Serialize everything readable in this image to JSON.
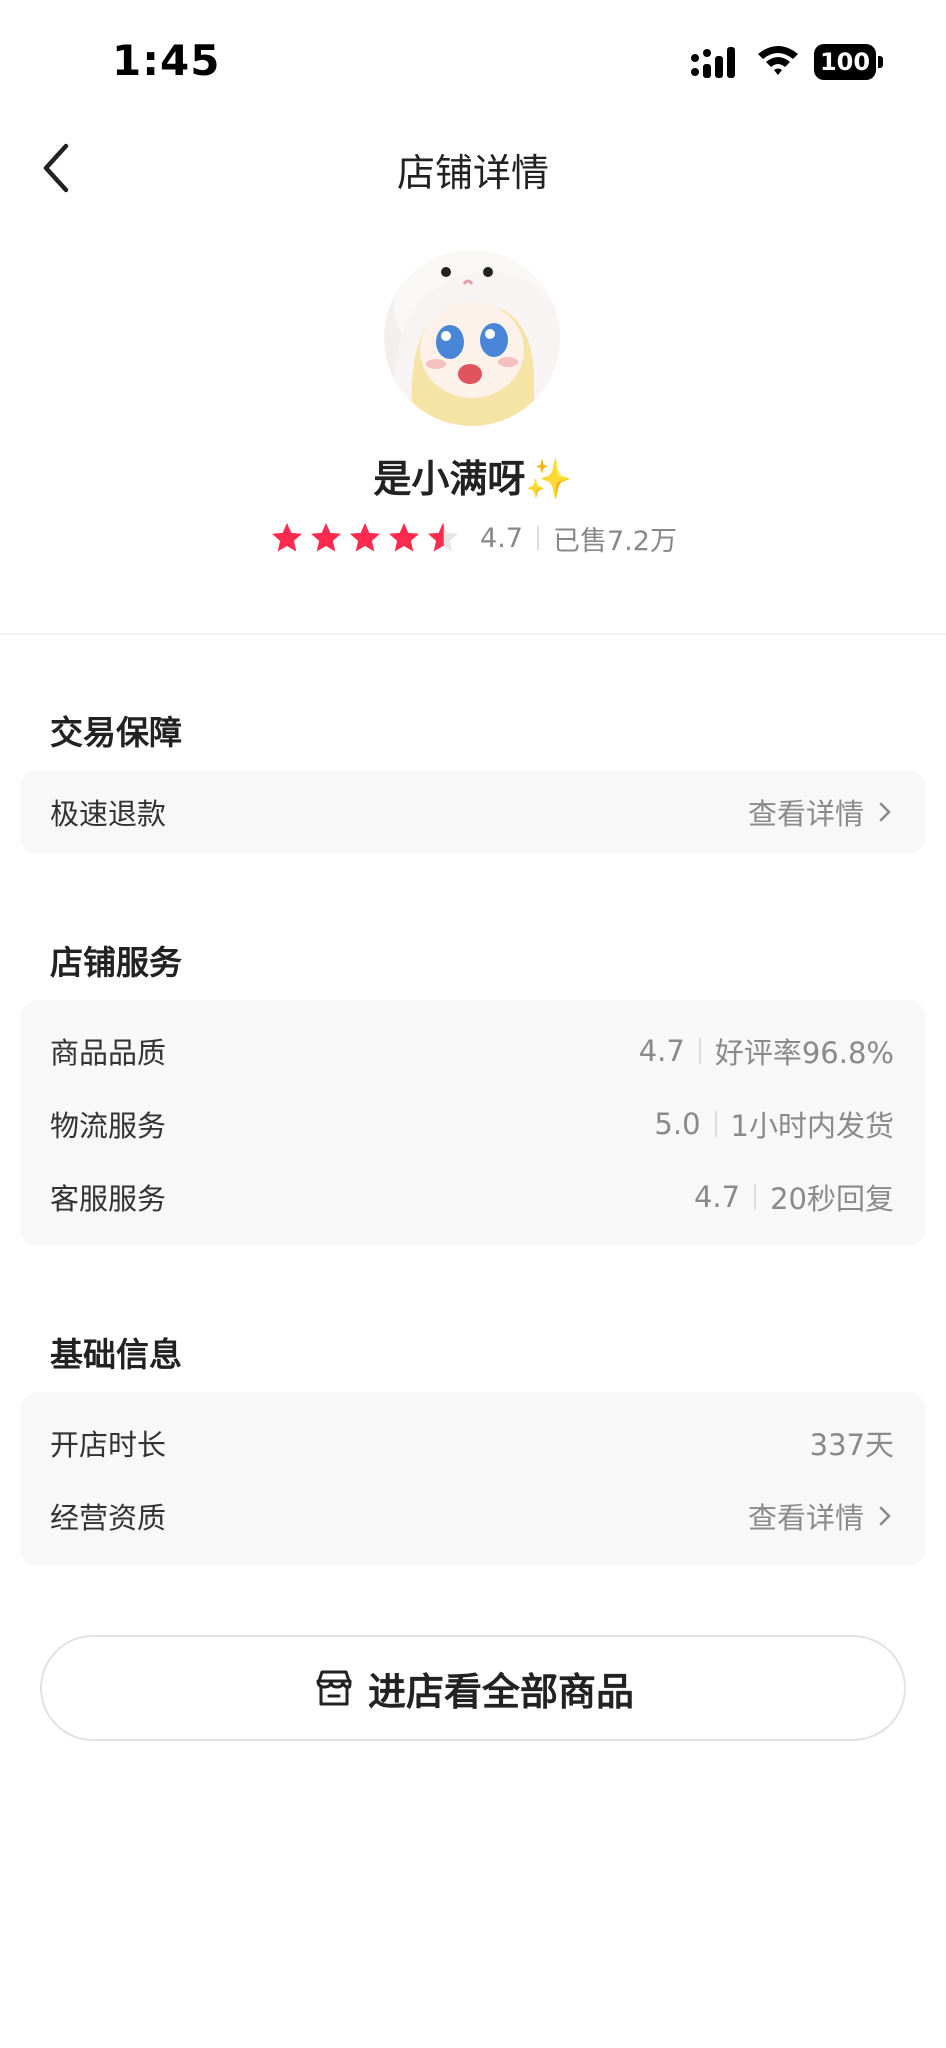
{
  "status_bar": {
    "time": "1:45",
    "battery": "100",
    "icons": [
      "signal-icon",
      "wifi-icon",
      "battery-icon"
    ]
  },
  "nav": {
    "back_icon": "chevron-left-icon",
    "title": "店铺详情"
  },
  "profile": {
    "name": "是小满呀✨",
    "rating": {
      "stars_value": 4.7,
      "stars_max": 5,
      "score": "4.7",
      "sold": "已售7.2万"
    },
    "star_color": "#ff2a4d"
  },
  "trade_guarantee": {
    "title": "交易保障",
    "rows": [
      {
        "label": "极速退款",
        "link": "查看详情"
      }
    ]
  },
  "shop_service": {
    "title": "店铺服务",
    "rows": [
      {
        "label": "商品品质",
        "score": "4.7",
        "detail": "好评率96.8%"
      },
      {
        "label": "物流服务",
        "score": "5.0",
        "detail": "1小时内发货"
      },
      {
        "label": "客服服务",
        "score": "4.7",
        "detail": "20秒回复"
      }
    ]
  },
  "basic_info": {
    "title": "基础信息",
    "rows": [
      {
        "label": "开店时长",
        "value": "337天"
      },
      {
        "label": "经营资质",
        "link": "查看详情"
      }
    ]
  },
  "enter_store": {
    "label": "进店看全部商品",
    "icon": "store-icon"
  },
  "colors": {
    "accent_star": "#ff2a4d",
    "card_bg": "#f8f8f8",
    "muted_text": "#8a8a8a"
  }
}
